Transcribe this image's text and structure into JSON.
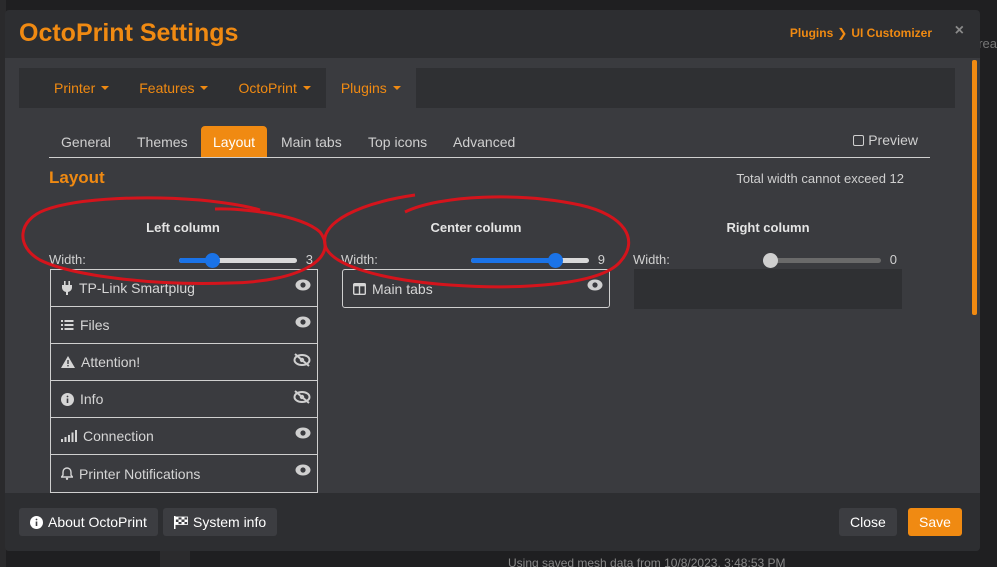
{
  "background": {
    "right_text": "rea",
    "status_text": "Using saved mesh data from 10/8/2023, 3:48:53 PM"
  },
  "modal": {
    "title": "OctoPrint Settings",
    "breadcrumb": {
      "parent": "Plugins",
      "current": "UI Customizer"
    },
    "close_label": "×"
  },
  "topnav": [
    {
      "label": "Printer"
    },
    {
      "label": "Features"
    },
    {
      "label": "OctoPrint"
    },
    {
      "label": "Plugins"
    }
  ],
  "tabs": [
    {
      "label": "General"
    },
    {
      "label": "Themes"
    },
    {
      "label": "Layout"
    },
    {
      "label": "Main tabs"
    },
    {
      "label": "Top icons"
    },
    {
      "label": "Advanced"
    }
  ],
  "active_tab": "Layout",
  "preview_label": "Preview",
  "layout": {
    "heading": "Layout",
    "note": "Total width cannot exceed 12",
    "width_label": "Width:",
    "columns": [
      {
        "title": "Left column",
        "width": "3",
        "fraction": 0.25
      },
      {
        "title": "Center column",
        "width": "9",
        "fraction": 0.75
      },
      {
        "title": "Right column",
        "width": "0",
        "fraction": 0
      }
    ],
    "left_panels": [
      {
        "label": "TP-Link Smartplug",
        "icon": "plug-icon",
        "visible": true
      },
      {
        "label": "Files",
        "icon": "list-icon",
        "visible": true
      },
      {
        "label": "Attention!",
        "icon": "warning-icon",
        "visible": false
      },
      {
        "label": "Info",
        "icon": "info-icon",
        "visible": false
      },
      {
        "label": "Connection",
        "icon": "signal-icon",
        "visible": true
      },
      {
        "label": "Printer Notifications",
        "icon": "bell-icon",
        "visible": true
      }
    ],
    "center_panels": [
      {
        "label": "Main tabs",
        "icon": "columns-icon",
        "visible": true
      }
    ]
  },
  "footer": {
    "about": "About OctoPrint",
    "system_info": "System info",
    "close": "Close",
    "save": "Save"
  },
  "colors": {
    "accent": "#f08a12",
    "slider": "#1a73e8",
    "annotation": "#d4141c"
  }
}
